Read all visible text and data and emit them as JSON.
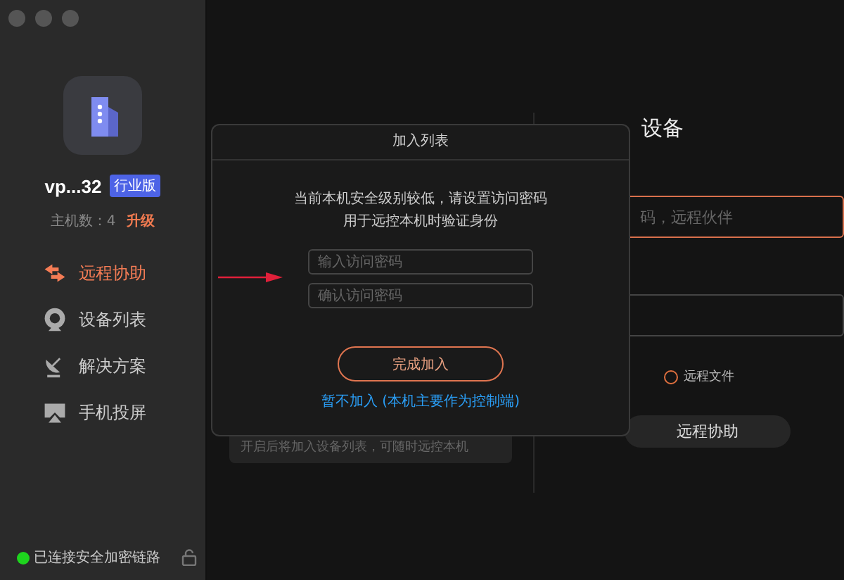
{
  "sidebar": {
    "account": "vp...32",
    "edition_badge": "行业版",
    "host_count": "主机数：4",
    "upgrade": "升级",
    "items": [
      {
        "label": "远程协助",
        "selected": true
      },
      {
        "label": "设备列表",
        "selected": false
      },
      {
        "label": "解决方案",
        "selected": false
      },
      {
        "label": "手机投屏",
        "selected": false
      }
    ],
    "status": {
      "text": "已连接安全加密链路",
      "connected": true
    }
  },
  "main": {
    "left": {
      "hint": "开启后将加入设备列表，可随时远控本机"
    },
    "right": {
      "heading": "设备",
      "device_field": {
        "placeholder": "码，远程伙伴"
      },
      "option": {
        "label": "远程文件",
        "checked": false
      },
      "button": "远程协助"
    }
  },
  "dialog": {
    "title": "加入列表",
    "message": [
      "当前本机安全级别较低，请设置访问密码",
      "用于远控本机时验证身份"
    ],
    "fields": [
      {
        "placeholder": "输入访问密码"
      },
      {
        "placeholder": "确认访问密码"
      }
    ],
    "confirm_button": "完成加入",
    "skip_link": "暂不加入 (本机主要作为控制端)"
  }
}
